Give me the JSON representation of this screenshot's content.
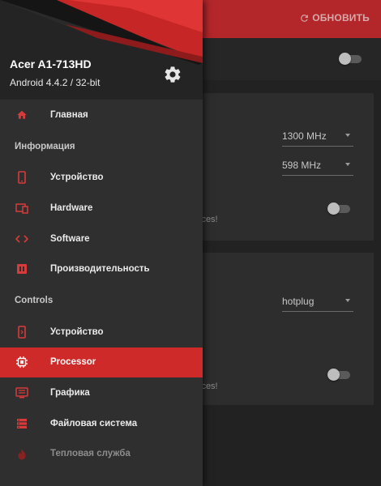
{
  "toolbar": {
    "refresh_label": "ОБНОВИТЬ"
  },
  "background": {
    "select_cpu_max": "1300 MHz",
    "select_cpu_min": "598 MHz",
    "select_governor": "hotplug",
    "partial_text_1": "ices!",
    "partial_text_2": "ices!"
  },
  "drawer": {
    "device_name": "Acer A1-713HD",
    "android_version": "Android 4.4.2 / 32-bit",
    "home_label": "Главная",
    "section_info": "Информация",
    "info_items": [
      "Устройство",
      "Hardware",
      "Software",
      "Производительность"
    ],
    "section_controls": "Controls",
    "controls_items": [
      "Устройство",
      "Processor",
      "Графика",
      "Файловая система",
      "Тепловая служба"
    ],
    "active_item": "Processor"
  },
  "colors": {
    "accent": "#cf2a2a",
    "toolbar": "#b3262a",
    "drawer_bg": "#2f2f2f",
    "icon_red": "#d93a3a"
  }
}
